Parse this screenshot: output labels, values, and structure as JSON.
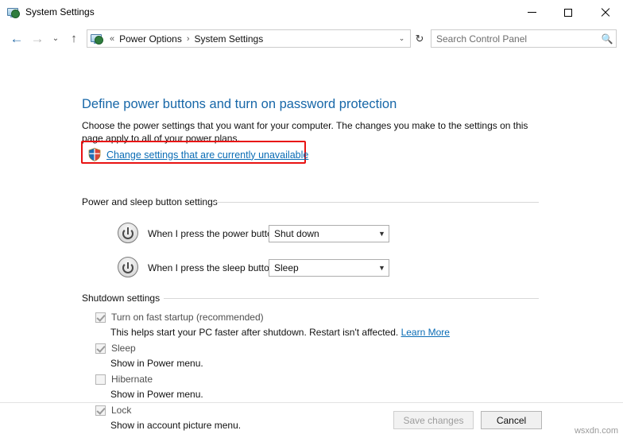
{
  "window": {
    "title": "System Settings",
    "icon": "system-settings-icon",
    "minimize": "–",
    "maximize": "□",
    "close": "✕"
  },
  "nav": {
    "back": "←",
    "forward": "→",
    "recent": "⌄",
    "up": "↑",
    "refresh": "↻"
  },
  "breadcrumb": {
    "chevron": "«",
    "items": [
      "Power Options",
      "System Settings"
    ],
    "separator": "›",
    "dropdown": "⌄"
  },
  "search": {
    "placeholder": "Search Control Panel",
    "icon": "search-icon"
  },
  "page": {
    "title": "Define power buttons and turn on password protection",
    "description": "Choose the power settings that you want for your computer. The changes you make to the settings on this page apply to all of your power plans.",
    "admin_link": "Change settings that are currently unavailable",
    "shield_icon": "uac-shield-icon",
    "highlight_color": "#e81313"
  },
  "power_sleep_section": {
    "label": "Power and sleep button settings",
    "rows": [
      {
        "icon": "power-button-icon",
        "label": "When I press the power button:",
        "value": "Shut down"
      },
      {
        "icon": "sleep-button-icon",
        "label": "When I press the sleep button:",
        "value": "Sleep"
      }
    ]
  },
  "shutdown_section": {
    "label": "Shutdown settings",
    "items": [
      {
        "label": "Turn on fast startup (recommended)",
        "checked": true,
        "sub": "This helps start your PC faster after shutdown. Restart isn't affected.",
        "sub_link": "Learn More"
      },
      {
        "label": "Sleep",
        "checked": true,
        "sub": "Show in Power menu.",
        "sub_link": ""
      },
      {
        "label": "Hibernate",
        "checked": false,
        "sub": "Show in Power menu.",
        "sub_link": ""
      },
      {
        "label": "Lock",
        "checked": true,
        "sub": "Show in account picture menu.",
        "sub_link": ""
      }
    ]
  },
  "footer": {
    "save": "Save changes",
    "cancel": "Cancel"
  },
  "watermark": "wsxdn.com"
}
